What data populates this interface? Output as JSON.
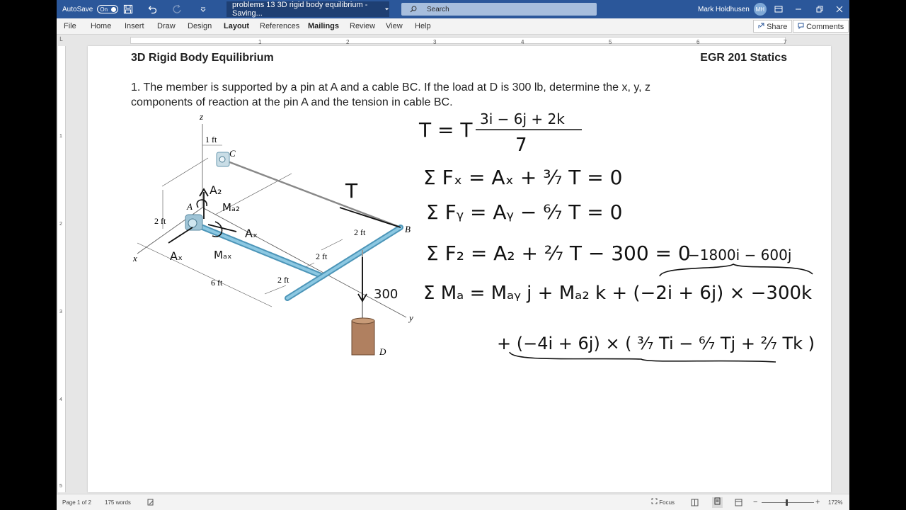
{
  "titlebar": {
    "autosave_label": "AutoSave",
    "autosave_state": "On",
    "doc_title": "problems 13 3D rigid body equilibrium  -  Saving...",
    "search_placeholder": "Search",
    "user_name": "Mark Holdhusen",
    "user_initials": "MH"
  },
  "ribbon": {
    "tabs": [
      "File",
      "Home",
      "Insert",
      "Draw",
      "Design",
      "Layout",
      "References",
      "Mailings",
      "Review",
      "View",
      "Help"
    ],
    "share_label": "Share",
    "comments_label": "Comments"
  },
  "ruler": {
    "numbers": [
      "1",
      "2",
      "3",
      "4",
      "5",
      "6",
      "7"
    ],
    "vnumbers": [
      "1",
      "2",
      "3",
      "4",
      "5"
    ]
  },
  "document": {
    "heading": "3D Rigid Body Equilibrium",
    "course": "EGR 201 Statics",
    "problem_line1": "1. The member is supported by a pin at A and a cable BC. If the load at D is 300 lb, determine the x, y, z",
    "problem_line2": "components of reaction at the pin A and the tension in cable BC."
  },
  "figure": {
    "labels": {
      "z": "z",
      "x": "x",
      "y": "y",
      "A": "A",
      "B": "B",
      "C": "C",
      "D": "D",
      "dim_1ft": "1 ft",
      "dim_2ft_a": "2 ft",
      "dim_2ft_b": "2 ft",
      "dim_2ft_c": "2 ft",
      "dim_2ft_d": "2 ft",
      "dim_6ft": "6 ft"
    },
    "handwritten": {
      "Az": "A₂",
      "MAz": "Mₐ₂",
      "Ay": "Aₓ",
      "Ax": "Aₓ",
      "MAy": "Mₐₓ",
      "T": "T",
      "load": "300"
    }
  },
  "equations": {
    "tension_vector": "T = T",
    "tension_numerator": "3i − 6j + 2k",
    "tension_denominator": "7",
    "sum_fx": "Σ Fₓ =  Aₓ + ³⁄₇ T  = 0",
    "sum_fy": "Σ Fᵧ = Aᵧ − ⁶⁄₇ T = 0",
    "sum_fz": "Σ F₂ = A₂ + ²⁄₇ T − 300 = 0",
    "moment_note": "−1800i − 600j",
    "sum_ma": "Σ Mₐ =  Mₐᵧ j + Mₐ₂ k  + (−2i + 6j) × −300k",
    "moment_line2": "+ (−4i + 6j) × ( ³⁄₇ Ti − ⁶⁄₇ Tj + ²⁄₇ Tk )"
  },
  "statusbar": {
    "page_info": "Page 1 of 2",
    "word_count": "175 words",
    "focus_label": "Focus",
    "zoom_level": "172%"
  },
  "colors": {
    "titlebar_bg": "#2b579a",
    "member_blue": "#6fb3d2",
    "weight_brown": "#b08060"
  }
}
